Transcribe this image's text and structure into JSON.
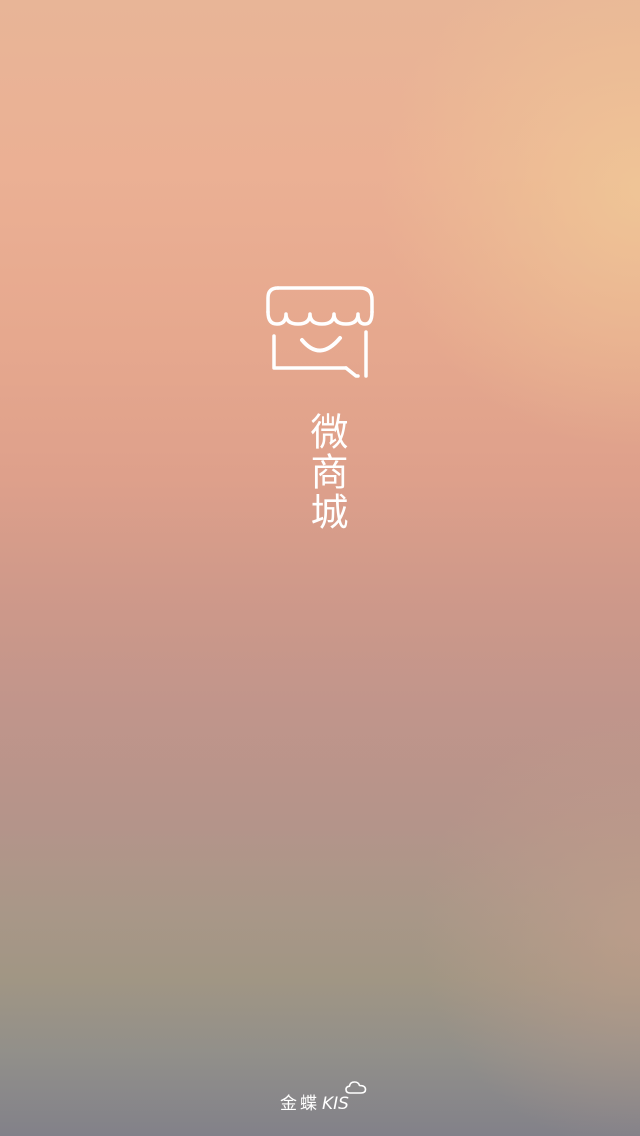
{
  "app": {
    "title": "微商城",
    "logo_icon": "storefront-smile-icon"
  },
  "footer": {
    "brand_cn": "金蝶",
    "brand_en": "KIS",
    "brand_icon": "cloud-icon"
  },
  "colors": {
    "text": "#ffffff",
    "bg_top": "#e8b597",
    "bg_mid": "#dea08b",
    "bg_bottom": "#828189",
    "glow": "#f0c896"
  }
}
